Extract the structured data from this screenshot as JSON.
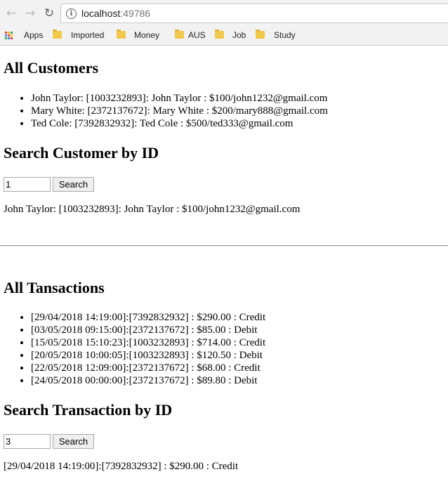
{
  "browser": {
    "url_host": "localhost",
    "url_port": ":49786",
    "bookmarks": [
      {
        "label": "Apps",
        "icon": "apps-grid-icon"
      },
      {
        "label": "Imported",
        "icon": "folder-icon"
      },
      {
        "label": "Money",
        "icon": "folder-icon"
      },
      {
        "label": "AUS",
        "icon": "folder-icon"
      },
      {
        "label": "Job",
        "icon": "folder-icon"
      },
      {
        "label": "Study",
        "icon": "folder-icon"
      }
    ]
  },
  "customers": {
    "heading": "All Customers",
    "items": [
      "John Taylor: [1003232893]: John Taylor : $100/john1232@gmail.com",
      "Mary White: [2372137672]: Mary White : $200/mary888@gmail.com",
      "Ted Cole: [7392832932]: Ted Cole : $500/ted333@gmail.com"
    ]
  },
  "customer_search": {
    "heading": "Search Customer by ID",
    "input_value": "1",
    "button_label": "Search",
    "result": "John Taylor: [1003232893]: John Taylor : $100/john1232@gmail.com"
  },
  "transactions": {
    "heading": "All Tansactions",
    "items": [
      "[29/04/2018 14:19:00]:[7392832932] : $290.00 : Credit",
      "[03/05/2018 09:15:00]:[2372137672] : $85.00 : Debit",
      "[15/05/2018 15:10:23]:[1003232893] : $714.00 : Credit",
      "[20/05/2018 10:00:05]:[1003232893] : $120.50 : Debit",
      "[22/05/2018 12:09:00]:[2372137672] : $68.00 : Credit",
      "[24/05/2018 00:00:00]:[2372137672] : $89.80 : Debit"
    ]
  },
  "transaction_search": {
    "heading": "Search Transaction by ID",
    "input_value": "3",
    "button_label": "Search",
    "result": "[29/04/2018 14:19:00]:[7392832932] : $290.00 : Credit"
  },
  "colors": {
    "folder": "#f2c84b",
    "chrome_bg": "#f2f2f2"
  }
}
